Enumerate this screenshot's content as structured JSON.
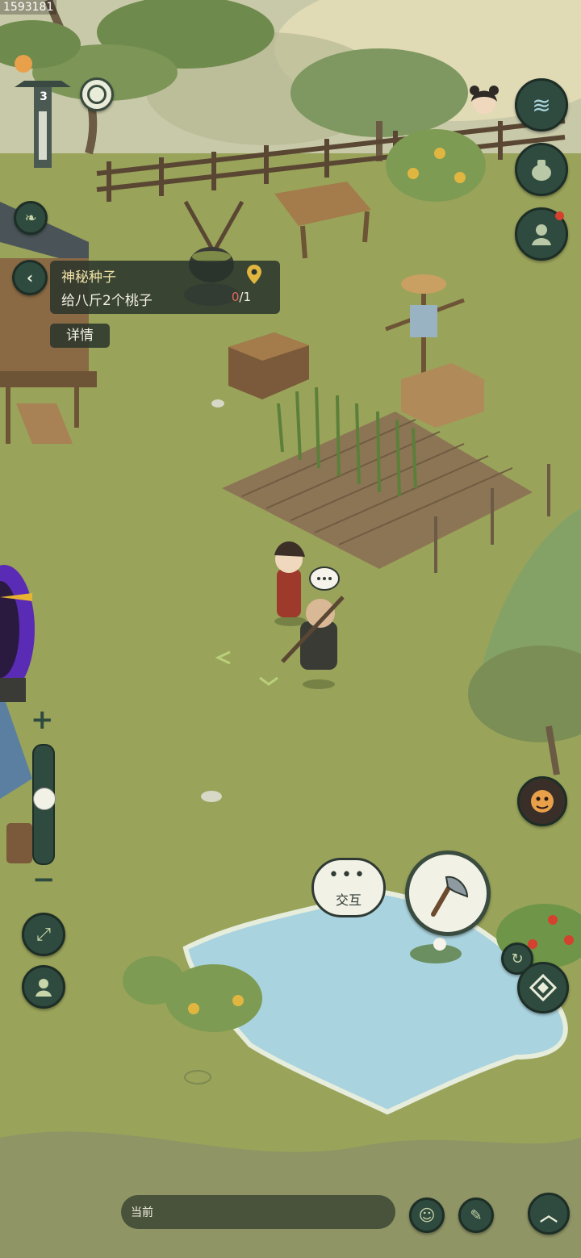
{
  "hud": {
    "id_label": "1593181",
    "level_badge": "3"
  },
  "quest": {
    "title": "神秘种子",
    "description": "给八斤2个桃子",
    "progress_current": "0",
    "progress_total": "/1",
    "details_label": "详情"
  },
  "actions": {
    "interact_label": "交互",
    "interact_dots": "•••"
  },
  "zoom": {
    "plus_label": "+",
    "minus_label": "−",
    "level": 0.57
  },
  "chat": {
    "channel_label": "当前"
  },
  "colors": {
    "panel": "#28342c",
    "button": "#2f4a3e",
    "grass": "#9aa35a",
    "water": "#a9d3de",
    "portal": "#5a2bb5"
  }
}
